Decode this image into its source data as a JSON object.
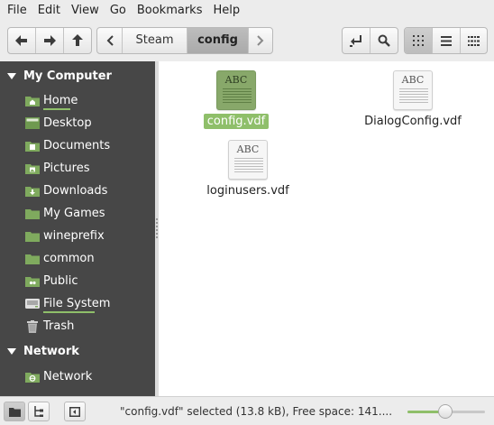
{
  "menubar": {
    "items": [
      "File",
      "Edit",
      "View",
      "Go",
      "Bookmarks",
      "Help"
    ]
  },
  "toolbar": {
    "nav_icons": [
      "arrow-left-icon",
      "arrow-right-icon",
      "arrow-up-icon"
    ],
    "breadcrumbs": [
      "Steam",
      "config"
    ],
    "active_crumb": "config",
    "view_icons": [
      "icon-view-icon",
      "list-view-icon",
      "compact-view-icon"
    ],
    "active_view": "icon-view"
  },
  "sidebar": {
    "sections": [
      {
        "title": "My Computer",
        "items": [
          {
            "label": "Home",
            "icon": "home-folder-icon",
            "usage": 0.77
          },
          {
            "label": "Desktop",
            "icon": "desktop-icon"
          },
          {
            "label": "Documents",
            "icon": "documents-folder-icon"
          },
          {
            "label": "Pictures",
            "icon": "pictures-folder-icon"
          },
          {
            "label": "Downloads",
            "icon": "downloads-folder-icon"
          },
          {
            "label": "My Games",
            "icon": "folder-icon"
          },
          {
            "label": "wineprefix",
            "icon": "folder-icon"
          },
          {
            "label": "common",
            "icon": "folder-icon"
          },
          {
            "label": "Public",
            "icon": "public-folder-icon"
          },
          {
            "label": "File System",
            "icon": "drive-icon",
            "usage": 0.77
          },
          {
            "label": "Trash",
            "icon": "trash-icon"
          }
        ]
      },
      {
        "title": "Network",
        "items": [
          {
            "label": "Network",
            "icon": "network-folder-icon"
          }
        ]
      }
    ]
  },
  "files": [
    {
      "name": "config.vdf",
      "icon": "text-file-icon",
      "icon_text": "ABC",
      "selected": true
    },
    {
      "name": "DialogConfig.vdf",
      "icon": "text-file-icon",
      "icon_text": "ABC",
      "selected": false
    },
    {
      "name": "loginusers.vdf",
      "icon": "text-file-icon",
      "icon_text": "ABC",
      "selected": false
    }
  ],
  "statusbar": {
    "text": "\"config.vdf\" selected (13.8 kB), Free space: 141....",
    "zoom_level": 0.49
  },
  "colors": {
    "accent": "#8fbf6a",
    "sidebar_bg": "#474747",
    "selection_icon": "#88a86a"
  }
}
